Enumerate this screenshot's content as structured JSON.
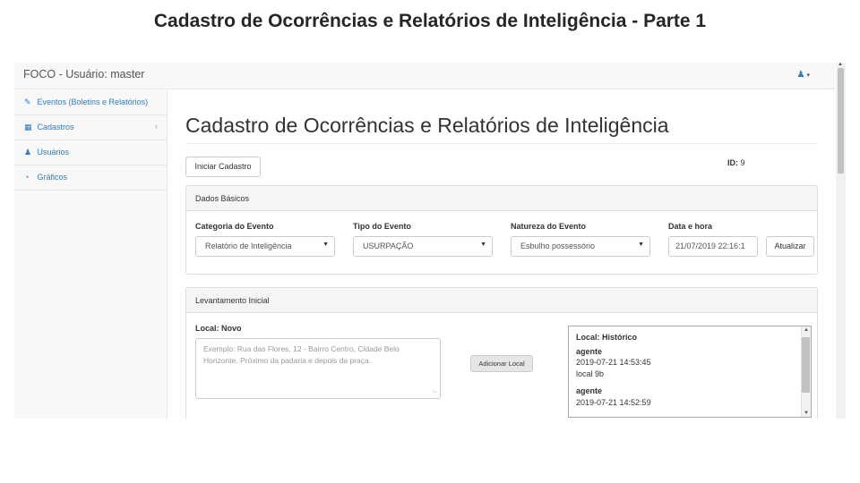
{
  "slide_title": "Cadastro de Ocorrências e Relatórios de Inteligência - Parte 1",
  "navbar": {
    "brand": "FOCO - Usuário: master",
    "user_icon": "user-icon",
    "caret": "▾"
  },
  "sidebar": {
    "items": [
      {
        "icon": "edit-icon",
        "glyph": "✎",
        "label": "Eventos (Boletins e Relatórios)"
      },
      {
        "icon": "table-icon",
        "glyph": "▦",
        "label": "Cadastros",
        "chevron": "‹"
      },
      {
        "icon": "users-icon",
        "glyph": "👥",
        "label": "Usuários"
      },
      {
        "icon": "dashboard-icon",
        "glyph": "◔",
        "label": "Gráficos"
      }
    ]
  },
  "main": {
    "title": "Cadastro de Ocorrências e Relatórios de Inteligência",
    "start_button": "Iniciar Cadastro",
    "id_label": "ID:",
    "id_value": "9"
  },
  "basic": {
    "heading": "Dados Básicos",
    "categoria_label": "Categoria do Evento",
    "categoria_value": "Relatório de Inteligência",
    "tipo_label": "Tipo do Evento",
    "tipo_value": "USURPAÇÃO",
    "natureza_label": "Natureza do Evento",
    "natureza_value": "Esbulho possessório",
    "data_label": "Data e hora",
    "data_value": "21/07/2019 22:16:1",
    "atualizar_button": "Atualizar"
  },
  "levantamento": {
    "heading": "Levantamento Inicial",
    "local_label": "Local: Novo",
    "local_placeholder": "Exemplo: Rua das Flores, 12 - Bairro Centro, Cidade Belo Horizonte. Próximo da padaria e depois da praça.",
    "add_button": "Adicionar Local",
    "history_title": "Local: Histórico",
    "history": [
      {
        "who": "agente",
        "when": "2019-07-21 14:53:45",
        "text": "local 9b"
      },
      {
        "who": "agente",
        "when": "2019-07-21 14:52:59",
        "text": ""
      }
    ]
  }
}
